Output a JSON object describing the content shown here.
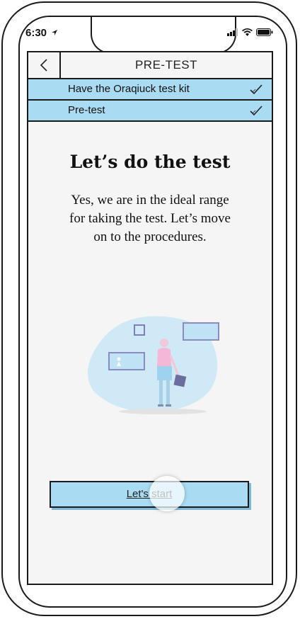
{
  "status_bar": {
    "time": "6:30"
  },
  "nav": {
    "back_icon": "chevron-left-icon",
    "title": "PRE-TEST"
  },
  "steps": [
    {
      "label": "Have the Oraqiuck test kit",
      "completed": true
    },
    {
      "label": "Pre-test",
      "completed": true
    }
  ],
  "main": {
    "heading": "Let’s do the test",
    "description": "Yes, we are in the ideal range for taking the test. Let’s move on to the procedures."
  },
  "cta": {
    "label": "Let's start"
  },
  "colors": {
    "accent": "#a9dbf3",
    "outline": "#1b1b1b",
    "screen_bg": "#f5f5f5",
    "illustration_blob": "#cfe9f6"
  }
}
